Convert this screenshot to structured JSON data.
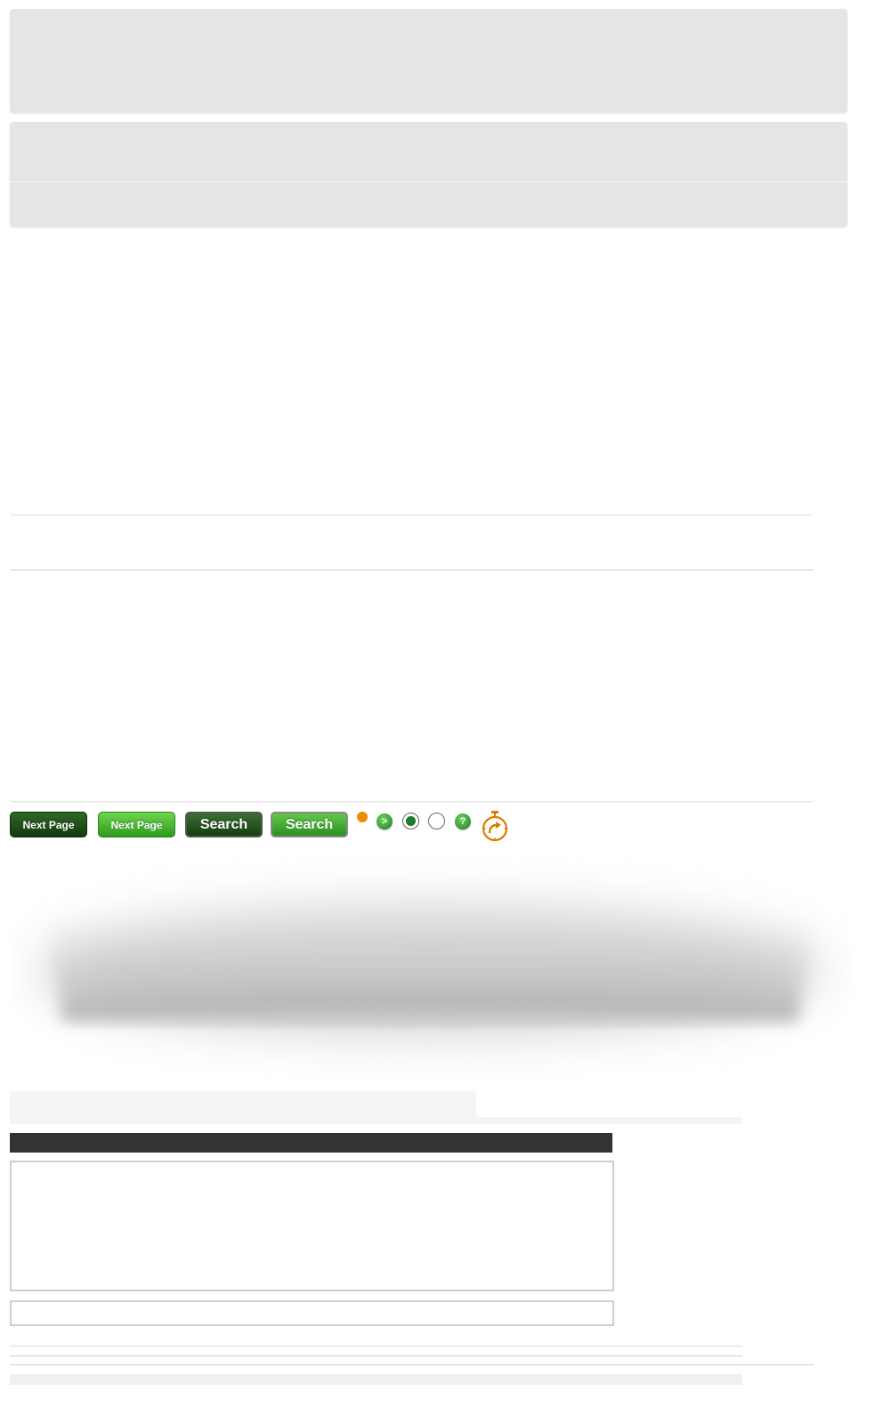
{
  "buttons": {
    "next_page_dark": "Next Page",
    "next_page_green": "Next Page",
    "search_dark": "Search",
    "search_green": "Search"
  },
  "icons": {
    "go": ">",
    "help": "?"
  },
  "colors": {
    "accent_green": "#2d9a1d",
    "dark_green": "#14380f",
    "orange": "#f08a00",
    "panel_gray": "#e5e5e5",
    "dark_bar": "#333333"
  }
}
